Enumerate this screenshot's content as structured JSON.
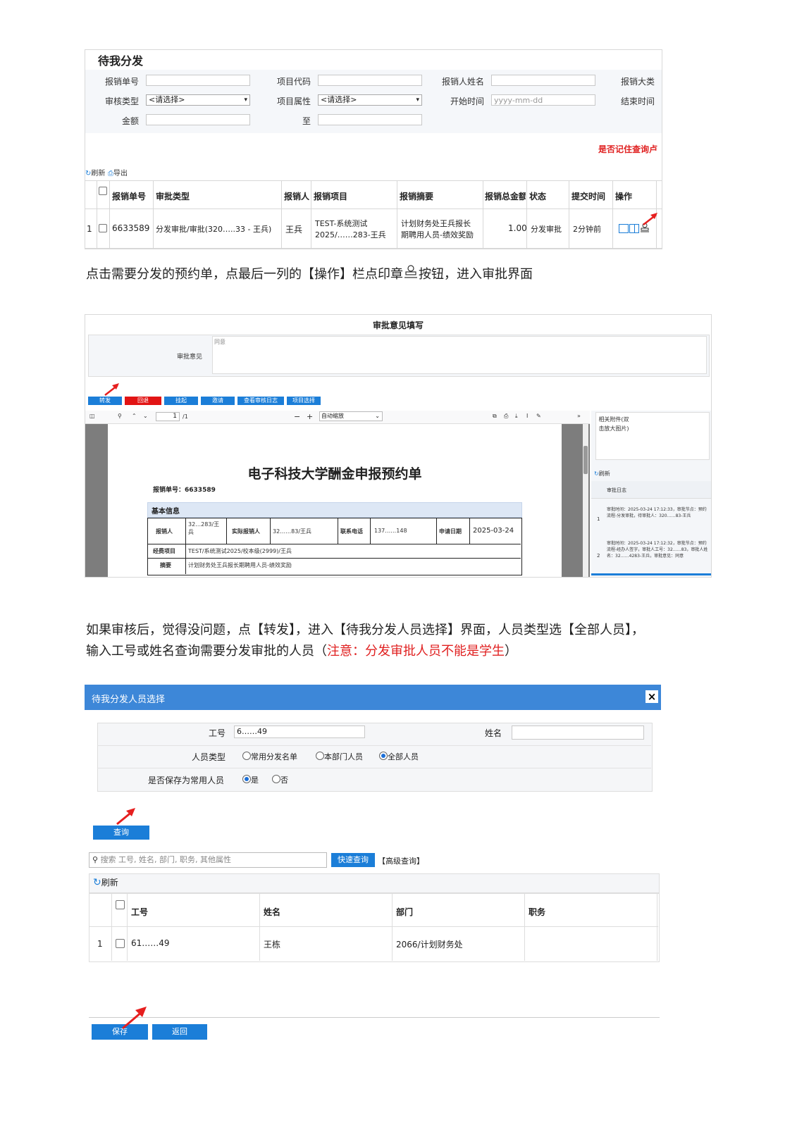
{
  "shot1": {
    "title": "待我分发",
    "search": {
      "bill_no_label": "报销单号",
      "project_code_label": "项目代码",
      "applicant_name_label": "报销人姓名",
      "category_label": "报销大类",
      "audit_type_label": "审核类型",
      "audit_type_value": "<请选择>",
      "project_attr_label": "项目属性",
      "project_attr_value": "<请选择>",
      "start_time_label": "开始时间",
      "start_time_placeholder": "yyyy-mm-dd",
      "end_time_label": "结束时间",
      "amount_label": "金额",
      "to_label": "至",
      "remember_text": "是否记住查询卢"
    },
    "toolbar": {
      "refresh": "刷新",
      "export": "导出"
    },
    "table": {
      "headers": [
        "报销单号",
        "审批类型",
        "报销人",
        "报销项目",
        "报销摘要",
        "报销总金额",
        "状态",
        "提交时间",
        "操作"
      ],
      "row": {
        "index": "1",
        "bill_no": "6633589",
        "type": "分发审批/审批(320…..33 - 王兵)",
        "person": "王兵",
        "project_line1": "TEST-系统测试",
        "project_line2": "2025/……283-王兵",
        "summary_line1": "计划财务处王兵报长",
        "summary_line2": "期聘用人员-绩效奖励",
        "amount": "1.00",
        "status": "分发审批",
        "time": "2分钟前"
      }
    }
  },
  "para1_a": "点击需要分发的预约单，点最后一列的【操作】栏点印章",
  "para1_b": "按钮，进入审批界面",
  "shot2": {
    "title": "审批意见填写",
    "opinion_label": "审批意见",
    "opinion_placeholder": "同意",
    "buttons": [
      "转发",
      "回退",
      "挂起",
      "邀请",
      "查看审核日志",
      "项目选择"
    ],
    "viewer": {
      "page": "1",
      "page_total": "/1",
      "zoom": "自动缩放"
    },
    "doc": {
      "title": "电子科技大学酬金申报预约单",
      "bill_no_label": "报销单号：",
      "bill_no": "6633589",
      "section": "基本信息",
      "applicant_label": "报销人",
      "applicant": "32…283/王兵",
      "actual_label": "实际报销人",
      "actual": "32……83/王兵",
      "phone_label": "联系电话",
      "phone": "137……148",
      "date_label": "申请日期",
      "date": "2025-03-24",
      "fund_label": "经费项目",
      "fund": "TEST/系统测试2025/校本级(2999)/王兵",
      "summary_label": "摘要",
      "summary": "计划财务处王兵报长期聘用人员-绩效奖励"
    },
    "side": {
      "attach": "相关附件(双击放大图片)",
      "refresh": "刷新",
      "log_title": "审批日志",
      "log1": "审批时间：2025-03-24 17:12:33，审批节点：预约流程-分发审批，待审批人：320……83-王兵",
      "log2": "审批时间：2025-03-24 17:12:32，审批节点：预约流程-经办人签字，审批人工号：32……83，审批人姓名：32……4283-王兵，审批意见：同意"
    }
  },
  "para2_line1": "如果审核后，觉得没问题，点【转发】，进入【待我分发人员选择】界面，人员类型选【全部人员】，",
  "para2_line2a": "输入工号或姓名查询需要分发审批的人员（",
  "para2_note": "注意：分发审批人员不能是学生",
  "para2_line2b": "）",
  "shot3": {
    "title": "待我分发人员选择",
    "close": "×",
    "emp_no_label": "工号",
    "emp_no_value": "6……49",
    "name_label": "姓名",
    "person_type_label": "人员类型",
    "type_options": [
      "常用分发名单",
      "本部门人员",
      "全部人员"
    ],
    "save_common_label": "是否保存为常用人员",
    "yes": "是",
    "no": "否",
    "query_btn": "查询",
    "search_placeholder": "搜索 工号, 姓名, 部门, 职务, 其他属性",
    "quick_query": "快速查询",
    "advanced_query": "【高级查询】",
    "refresh": "刷新",
    "headers": [
      "工号",
      "姓名",
      "部门",
      "职务"
    ],
    "row": {
      "index": "1",
      "emp_no": "61……49",
      "name": "王栋",
      "dept": "2066/计划财务处",
      "title": ""
    },
    "save_btn": "保存",
    "back_btn": "返回"
  }
}
